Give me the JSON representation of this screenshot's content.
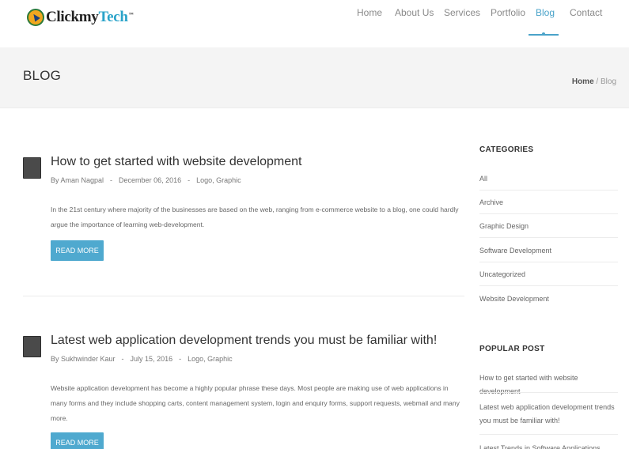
{
  "logo": {
    "part1": "Clickmy",
    "part2": "Tech",
    "tm": "™"
  },
  "nav": {
    "items": [
      {
        "label": "Home"
      },
      {
        "label": "About Us"
      },
      {
        "label": "Services"
      },
      {
        "label": "Portfolio"
      },
      {
        "label": "Blog",
        "active": true
      },
      {
        "label": "Contact"
      }
    ]
  },
  "titlebar": {
    "title": "BLOG",
    "breadcrumb_home": "Home",
    "breadcrumb_sep": "/",
    "breadcrumb_current": "Blog"
  },
  "posts": [
    {
      "title": "How to get started with website development",
      "author": "By Aman Nagpal",
      "date": "December 06, 2016",
      "categories": "Logo, Graphic",
      "excerpt": "In the 21st century where majority of the businesses are based on the web, ranging from e-commerce website to a blog, one could hardly argue the importance of learning web-development.",
      "button": "READ MORE"
    },
    {
      "title": "Latest web application development trends you must be familiar with!",
      "author": "By Sukhwinder Kaur",
      "date": "July 15, 2016",
      "categories": "Logo, Graphic",
      "excerpt": "Website application development has become a highly popular phrase these days. Most people are making use of web applications in many forms and they include shopping carts, content management system, login and enquiry forms, support requests, webmail and many more.",
      "button": "READ MORE"
    }
  ],
  "meta_sep": "-",
  "sidebar": {
    "categories_title": "CATEGORIES",
    "categories": [
      "All",
      "Archive",
      "Graphic Design",
      "Software Development",
      "Uncategorized",
      "Website Development"
    ],
    "popular_title": "POPULAR POST",
    "popular": [
      "How to get started with website development",
      "Latest web application development trends you must be familiar with!",
      "Latest Trends in Software Applications"
    ]
  },
  "colors": {
    "accent": "#4fa9cf",
    "nav_active": "#4aa3c9",
    "titlebar_bg": "#f4f4f4"
  }
}
